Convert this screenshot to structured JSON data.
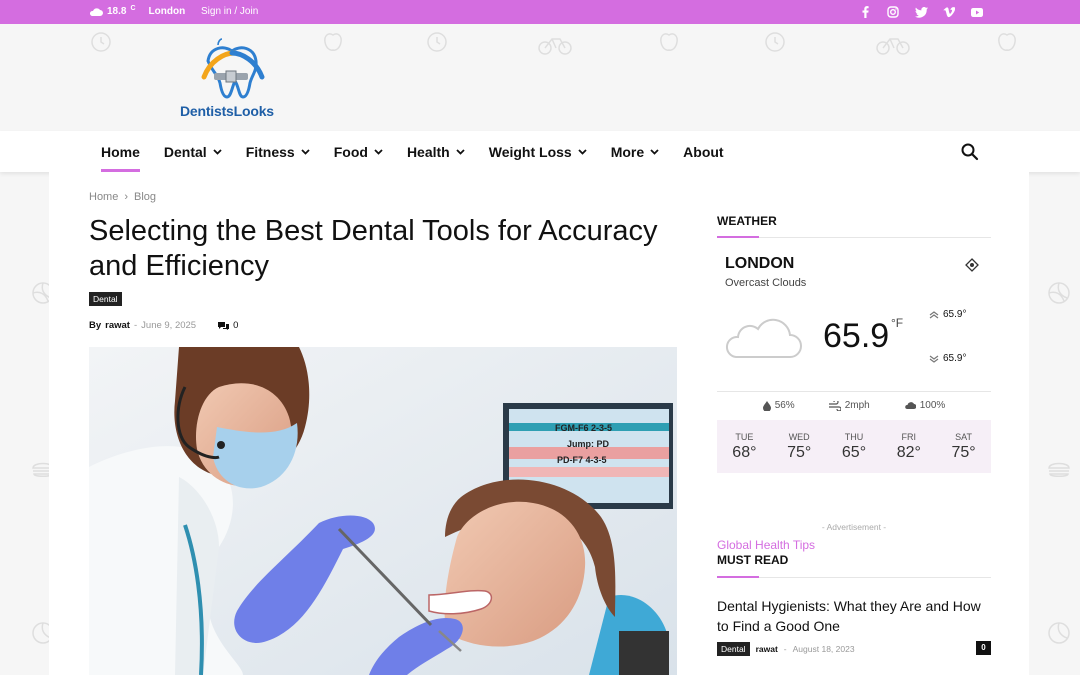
{
  "topbar": {
    "temp": "18.8",
    "unit": "C",
    "city": "London",
    "signin": "Sign in / Join",
    "socials": [
      "facebook-icon",
      "instagram-icon",
      "twitter-icon",
      "vimeo-icon",
      "youtube-icon"
    ],
    "bg_color": "#d46de0"
  },
  "logo": {
    "brand": "DentistsLooks"
  },
  "nav": {
    "items": [
      {
        "label": "Home",
        "dropdown": false,
        "active": true
      },
      {
        "label": "Dental",
        "dropdown": true
      },
      {
        "label": "Fitness",
        "dropdown": true
      },
      {
        "label": "Food",
        "dropdown": true
      },
      {
        "label": "Health",
        "dropdown": true
      },
      {
        "label": "Weight Loss",
        "dropdown": true
      },
      {
        "label": "More",
        "dropdown": true
      },
      {
        "label": "About",
        "dropdown": false
      }
    ]
  },
  "breadcrumb": {
    "home": "Home",
    "sep": "›",
    "current": "Blog"
  },
  "article": {
    "title": "Selecting the Best Dental Tools for Accuracy and Efficiency",
    "category": "Dental",
    "by": "By",
    "author": "rawat",
    "date_sep": "-",
    "date": "June 9, 2025",
    "comments": "0",
    "monitor_text": [
      "FGM-F6  2-3-5",
      "Jump: PD",
      "PD-F7  4-3-5"
    ]
  },
  "weather": {
    "heading": "WEATHER",
    "city": "LONDON",
    "desc": "Overcast Clouds",
    "temp": "65.9",
    "unit": "°F",
    "high": "65.9°",
    "low": "65.9°",
    "humidity": "56%",
    "wind": "2mph",
    "clouds": "100%",
    "days": [
      {
        "d": "TUE",
        "t": "68°"
      },
      {
        "d": "WED",
        "t": "75°"
      },
      {
        "d": "THU",
        "t": "65°"
      },
      {
        "d": "FRI",
        "t": "82°"
      },
      {
        "d": "SAT",
        "t": "75°"
      }
    ]
  },
  "sidebar": {
    "ad": "- Advertisement -",
    "global": "Global Health Tips",
    "must_read": "MUST READ",
    "post": {
      "title": "Dental Hygienists: What they Are and How to Find a Good One",
      "tag": "Dental",
      "author": "rawat",
      "sep": "-",
      "date": "August 18, 2023",
      "count": "0"
    }
  },
  "colors": {
    "accent": "#d46de0",
    "brand_blue": "#1f5fa7"
  }
}
